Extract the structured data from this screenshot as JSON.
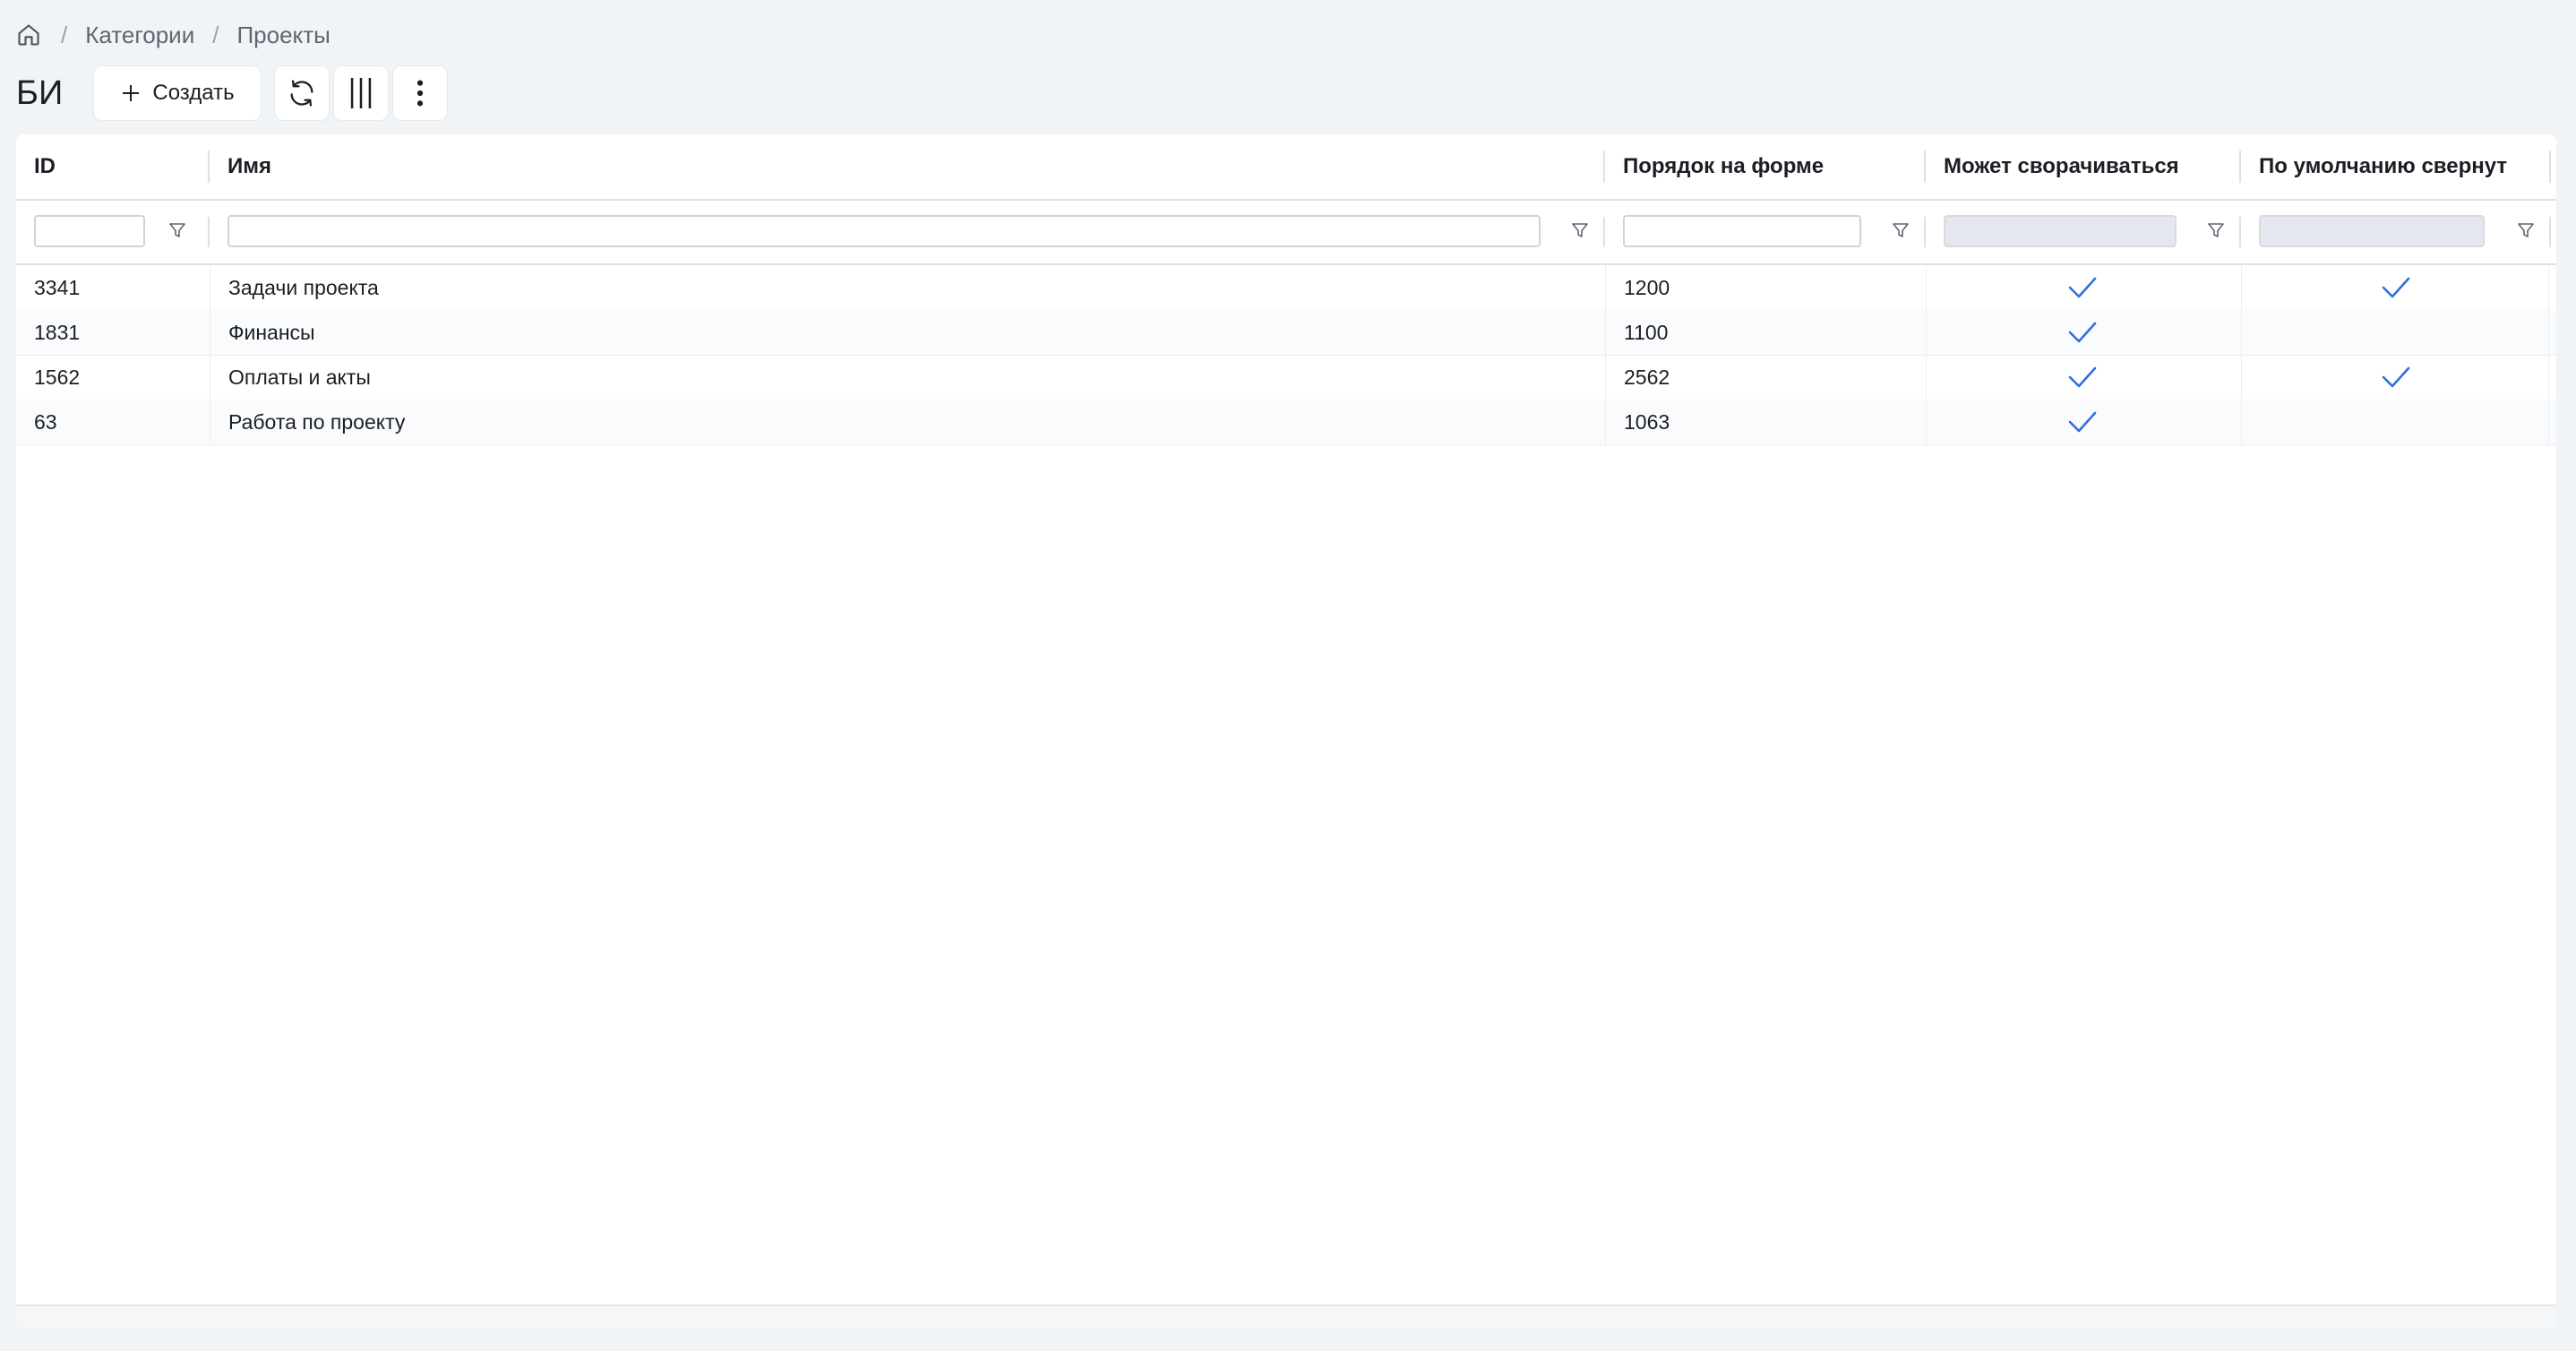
{
  "breadcrumb": {
    "items": [
      "Категории",
      "Проекты"
    ]
  },
  "page": {
    "title": "БИ"
  },
  "toolbar": {
    "create_label": "Создать"
  },
  "table": {
    "columns": [
      {
        "key": "id",
        "label": "ID",
        "filter": "text"
      },
      {
        "key": "name",
        "label": "Имя",
        "filter": "text"
      },
      {
        "key": "order",
        "label": "Порядок на форме",
        "filter": "text"
      },
      {
        "key": "collapsible",
        "label": "Может сворачиваться",
        "filter": "disabled"
      },
      {
        "key": "collapsed",
        "label": "По умолчанию свернут",
        "filter": "disabled"
      }
    ],
    "rows": [
      {
        "id": "3341",
        "name": "Задачи проекта",
        "order": "1200",
        "collapsible": true,
        "collapsed": true
      },
      {
        "id": "1831",
        "name": "Финансы",
        "order": "1100",
        "collapsible": true,
        "collapsed": false
      },
      {
        "id": "1562",
        "name": "Оплаты и акты",
        "order": "2562",
        "collapsible": true,
        "collapsed": true
      },
      {
        "id": "63",
        "name": "Работа по проекту",
        "order": "1063",
        "collapsible": true,
        "collapsed": false
      }
    ]
  },
  "colors": {
    "accent": "#2f6fe0",
    "background": "#f1f4f7"
  }
}
